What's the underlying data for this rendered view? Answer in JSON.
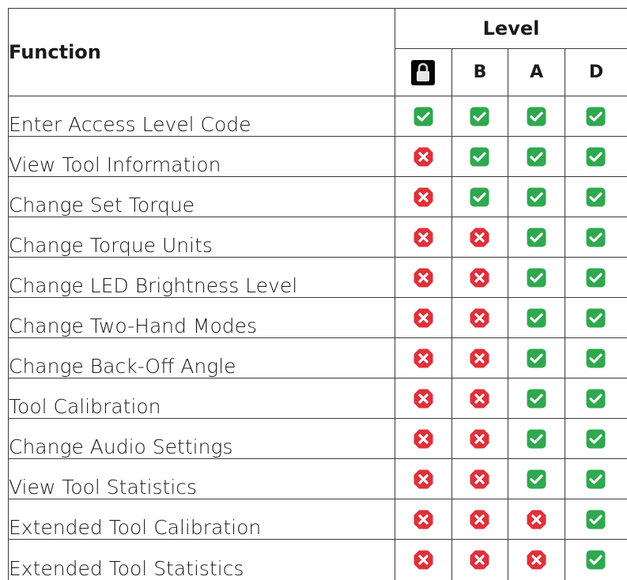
{
  "table": {
    "function_header": "Function",
    "level_header": "Level",
    "level_columns": [
      {
        "key": "lock",
        "label": "",
        "icon": "lock-icon"
      },
      {
        "key": "B",
        "label": "B"
      },
      {
        "key": "A",
        "label": "A"
      },
      {
        "key": "D",
        "label": "D"
      }
    ],
    "rows": [
      {
        "function": "Enter Access Level Code",
        "lock": true,
        "B": true,
        "A": true,
        "D": true
      },
      {
        "function": "View Tool Information",
        "lock": false,
        "B": true,
        "A": true,
        "D": true
      },
      {
        "function": "Change Set Torque",
        "lock": false,
        "B": true,
        "A": true,
        "D": true
      },
      {
        "function": "Change Torque Units",
        "lock": false,
        "B": false,
        "A": true,
        "D": true
      },
      {
        "function": "Change LED Brightness Level",
        "lock": false,
        "B": false,
        "A": true,
        "D": true
      },
      {
        "function": "Change Two-Hand Modes",
        "lock": false,
        "B": false,
        "A": true,
        "D": true
      },
      {
        "function": "Change Back-Off Angle",
        "lock": false,
        "B": false,
        "A": true,
        "D": true
      },
      {
        "function": "Tool Calibration",
        "lock": false,
        "B": false,
        "A": true,
        "D": true
      },
      {
        "function": "Change Audio Settings",
        "lock": false,
        "B": false,
        "A": true,
        "D": true
      },
      {
        "function": "View Tool Statistics",
        "lock": false,
        "B": false,
        "A": true,
        "D": true
      },
      {
        "function": "Extended Tool Calibration",
        "lock": false,
        "B": false,
        "A": false,
        "D": true
      },
      {
        "function": "Extended Tool Statistics",
        "lock": false,
        "B": false,
        "A": false,
        "D": true
      }
    ]
  },
  "colors": {
    "allowed": "#2fa84f",
    "denied": "#e0303a",
    "border": "#3a3a3a"
  }
}
